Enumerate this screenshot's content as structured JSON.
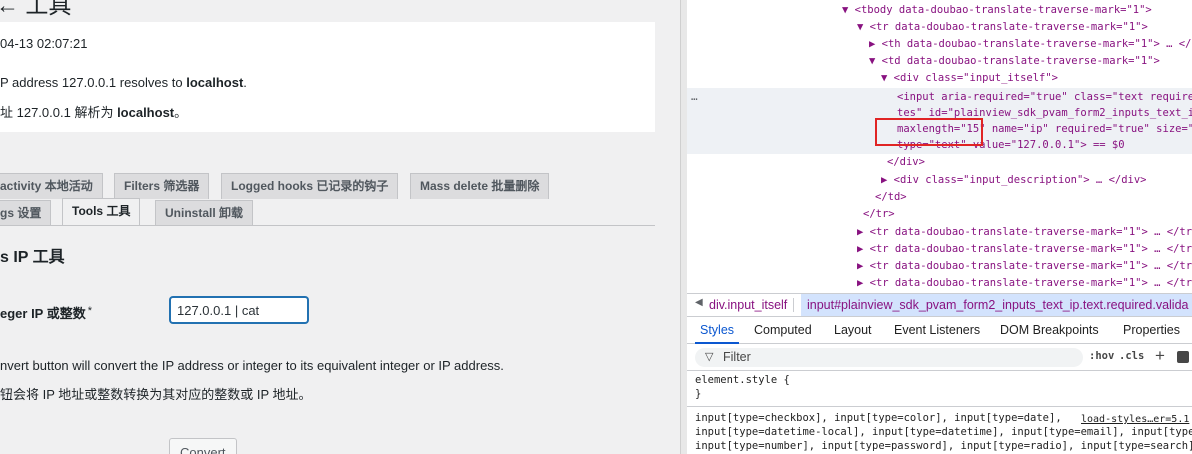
{
  "page": {
    "heading": "← 工具",
    "notice": {
      "timestamp": "04-13 02:07:21",
      "en_prefix": "P address 127.0.0.1 resolves to ",
      "en_host": "localhost",
      "en_suffix": ".",
      "zh_prefix": "址 127.0.0.1 解析为 ",
      "zh_host": "localhost",
      "zh_suffix": "。"
    },
    "tabs_row1": [
      "activity 本地活动",
      "Filters 筛选器",
      "Logged hooks 已记录的钩子",
      "Mass delete 批量删除"
    ],
    "tabs_row2": [
      "gs 设置",
      "Tools 工具",
      "Uninstall 卸载"
    ],
    "active_tab": "Tools 工具",
    "section_title": "s IP 工具",
    "field_label": "eger IP 或整数",
    "required_mark": "*",
    "ip_value": "127.0.0.1 | cat",
    "desc_en": "nvert button will convert the IP address or integer to its equivalent integer or IP address.",
    "desc_zh": "钮会将 IP 地址或整数转换为其对应的整数或 IP 地址。",
    "convert_label": "Convert"
  },
  "devtools": {
    "dom_lines": [
      "▼ <tbody data-doubao-translate-traverse-mark=\"1\">",
      "▼ <tr data-doubao-translate-traverse-mark=\"1\">",
      "▶ <th data-doubao-translate-traverse-mark=\"1\"> … </th>",
      "▼ <td data-doubao-translate-traverse-mark=\"1\">",
      "▼ <div class=\"input_itself\">",
      "<input aria-required=\"true\" class=\"text required t",
      "tes\" id=\"plainview_sdk_pvam_form2_inputs_text_ip\"",
      "maxlength=\"15\" name=\"ip\" required=\"true\" size=\"15",
      "type=\"text\" value=\"127.0.0.1\"> == $0",
      "</div>",
      "▶ <div class=\"input_description\"> … </div>",
      "</td>",
      "</tr>",
      "▶ <tr data-doubao-translate-traverse-mark=\"1\"> … </tr>",
      "▶ <tr data-doubao-translate-traverse-mark=\"1\"> … </tr>",
      "▶ <tr data-doubao-translate-traverse-mark=\"1\"> … </tr>",
      "▶ <tr data-doubao-translate-traverse-mark=\"1\"> … </tr>"
    ],
    "dots": "…",
    "breadcrumb": [
      "div.input_itself",
      "input#plainview_sdk_pvam_form2_inputs_text_ip.text.required.valida"
    ],
    "panel_tabs": [
      "Styles",
      "Computed",
      "Layout",
      "Event Listeners",
      "DOM Breakpoints",
      "Properties"
    ],
    "active_panel_tab": "Styles",
    "filter_placeholder": "Filter",
    "hov": ":hov",
    "cls": ".cls",
    "element_style_open": "element.style {",
    "element_style_close": "}",
    "rule_lines": [
      "input[type=checkbox], input[type=color], input[type=date],",
      "input[type=datetime-local], input[type=datetime], input[type=email], input[type=mon",
      "input[type=number], input[type=password], input[type=radio], input[type=search],"
    ],
    "source_link": "load-styles…er=5.1"
  }
}
